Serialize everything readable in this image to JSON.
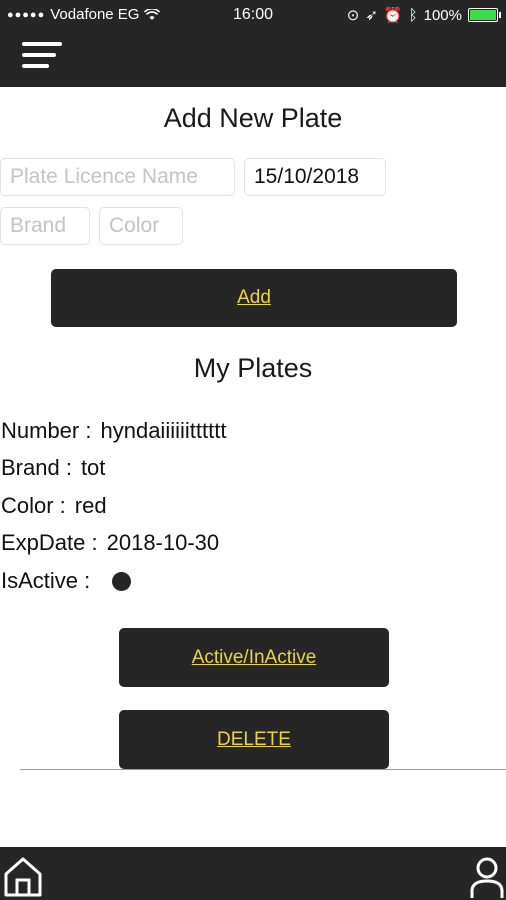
{
  "status_bar": {
    "carrier": "Vodafone EG",
    "time": "16:00",
    "battery": "100%",
    "battery_level": 1.0
  },
  "header": {
    "menu_icon": "hamburger-menu-icon"
  },
  "form": {
    "title": "Add New Plate",
    "plate_placeholder": "Plate Licence Name",
    "date_value": "15/10/2018",
    "brand_placeholder": "Brand",
    "color_placeholder": "Color",
    "add_label": "Add"
  },
  "plates": {
    "title": "My Plates",
    "items": [
      {
        "number_label": "Number :",
        "number": "hyndaiiiiiitttttt",
        "brand_label": "Brand :",
        "brand": "tot",
        "color_label": "Color :",
        "color": "red",
        "exp_label": "ExpDate :",
        "exp_date": "2018-10-30",
        "active_label": "IsActive :",
        "active_indicator": "filled-dot",
        "toggle_label": "Active/InActive",
        "delete_label": "DELETE"
      }
    ]
  },
  "bottom_nav": {
    "home_icon": "home-icon",
    "profile_icon": "user-icon"
  },
  "colors": {
    "bar": "#262626",
    "button_text": "#e8d63a",
    "battery": "#3ddc4b"
  }
}
